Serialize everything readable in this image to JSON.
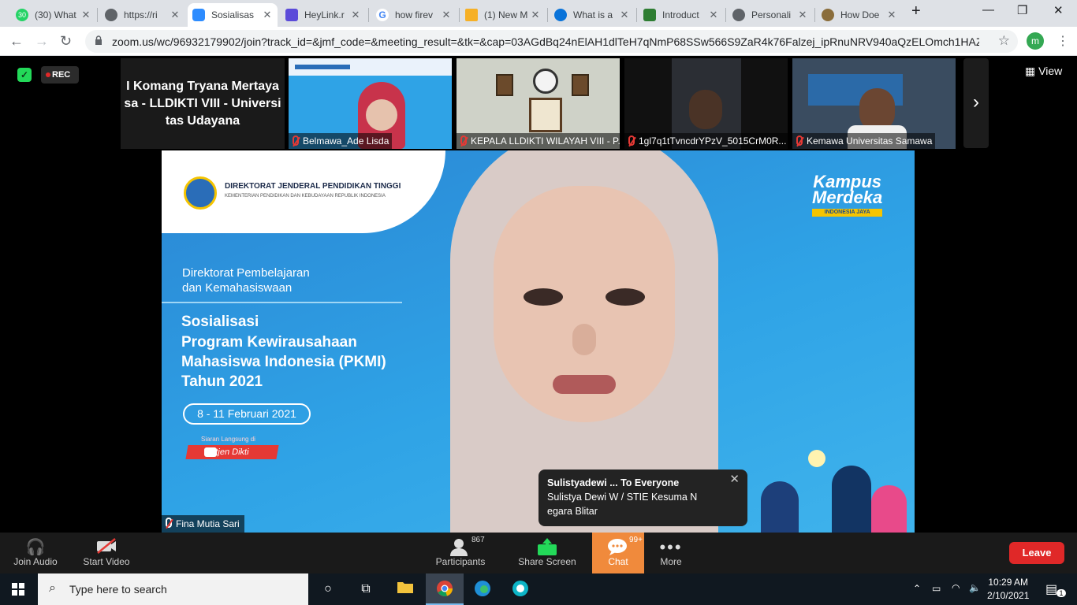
{
  "browser": {
    "tabs": [
      {
        "title": "(30) What",
        "fav": "30",
        "fav_color": "#25d366"
      },
      {
        "title": "https://ri",
        "fav": "",
        "fav_color": "#5f6368"
      },
      {
        "title": "Sosialisas",
        "fav": "",
        "fav_color": "#2d8cff"
      },
      {
        "title": "HeyLink.r",
        "fav": "",
        "fav_color": "#5b4bd9"
      },
      {
        "title": "how firev",
        "fav": "G",
        "fav_color": "#4285f4"
      },
      {
        "title": "(1) New M",
        "fav": "",
        "fav_color": "#f6b026"
      },
      {
        "title": "What is a",
        "fav": "",
        "fav_color": "#0a73d9"
      },
      {
        "title": "Introduct",
        "fav": "",
        "fav_color": "#2e7d32"
      },
      {
        "title": "Personali",
        "fav": "",
        "fav_color": "#5f6368"
      },
      {
        "title": "How Doe",
        "fav": "",
        "fav_color": "#8a6d3b"
      }
    ],
    "new_tab": "+",
    "url": "zoom.us/wc/96932179902/join?track_id=&jmf_code=&meeting_result=&tk=&cap=03AGdBq24nElAH1dlTeH7qNmP68SSw566S9ZaR4k76Falzej_ipRnuNRV940aQzELOmch1HAZ3e...",
    "profile_initial": "m"
  },
  "zoom": {
    "rec_label": "REC",
    "view_label": "View",
    "text_participant": "I Komang Tryana Mertaya sa - LLDIKTI VIII - Universi tas Udayana",
    "thumbnails": [
      {
        "name": "Belmawa_Ade Lisda"
      },
      {
        "name": "KEPALA LLDIKTI WILAYAH VIII - P..."
      },
      {
        "name": "1gl7q1tTvncdrYPzV_5015CrM0R..."
      },
      {
        "name": "Kemawa Universitas Samawa"
      }
    ],
    "main_speaker": "Fina Mutia Sari",
    "slide": {
      "org_title": "DIREKTORAT JENDERAL PENDIDIKAN TINGGI",
      "org_subtitle": "KEMENTERIAN PENDIDIKAN DAN KEBUDAYAAN REPUBLIK INDONESIA",
      "brand_line1": "Kampus",
      "brand_line2": "Merdeka",
      "brand_tag": "INDONESIA JAYA",
      "directorate_line1": "Direktorat Pembelajaran",
      "directorate_line2": "dan Kemahasiswaan",
      "title_line1": "Sosialisasi",
      "title_line2": "Program Kewirausahaan",
      "title_line3": "Mahasiswa Indonesia (PKMI)",
      "title_line4": "Tahun 2021",
      "date": "8 - 11 Februari 2021",
      "live_label": "Siaran Langsung di",
      "channel": "Ditjen Dikti"
    },
    "chat_popup": {
      "header": "Sulistyadewi ... To Everyone",
      "line1": "Sulistya Dewi W / STIE Kesuma N",
      "line2": "egara Blitar"
    },
    "controls": {
      "join_audio": "Join Audio",
      "start_video": "Start Video",
      "participants": "Participants",
      "participants_count": "867",
      "share_screen": "Share Screen",
      "chat": "Chat",
      "chat_badge": "99+",
      "more": "More",
      "leave": "Leave"
    }
  },
  "taskbar": {
    "search_placeholder": "Type here to search",
    "time": "10:29 AM",
    "date": "2/10/2021",
    "notif_count": "1"
  }
}
